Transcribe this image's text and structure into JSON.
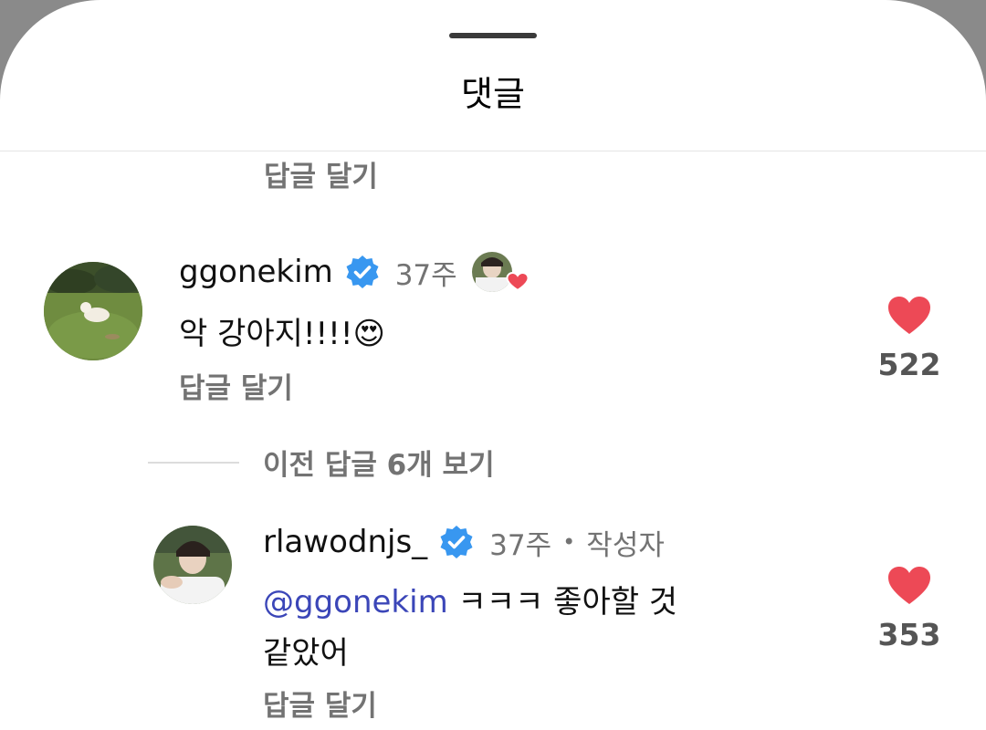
{
  "header": {
    "title": "댓글"
  },
  "top_reply_link": "답글 달기",
  "comments": [
    {
      "username": "ggonekim",
      "time": "37주",
      "text": "악 강아지!!!!😍",
      "reply_label": "답글 달기",
      "likes": "522",
      "liked_by_author": true
    }
  ],
  "view_previous_replies": "이전 답글 6개 보기",
  "replies": [
    {
      "username": "rlawodnjs_",
      "time": "37주",
      "separator": "•",
      "author_label": "작성자",
      "mention": "@ggonekim",
      "text_line1": " ㅋㅋㅋ 좋아할 것",
      "text_line2": "같았어",
      "reply_label": "답글 달기",
      "likes": "353"
    }
  ],
  "colors": {
    "like_red": "#ed4956",
    "verified_blue": "#3897f0",
    "secondary_text": "#737373",
    "mention_blue": "#3b46b8"
  }
}
